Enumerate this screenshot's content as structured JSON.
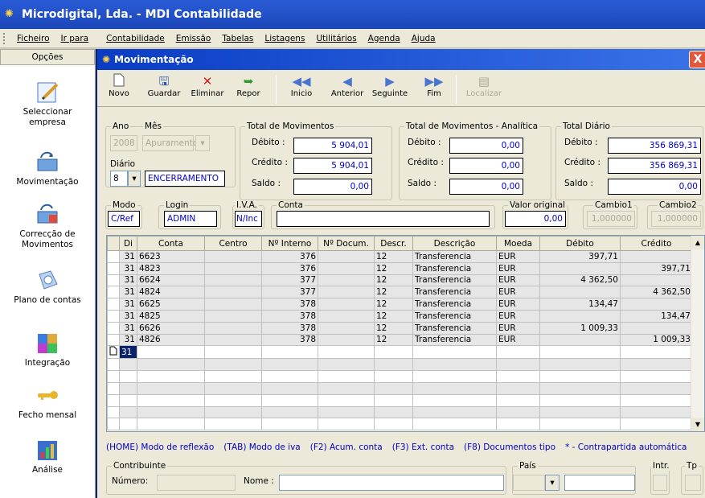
{
  "app": {
    "title": "Microdigital, Lda. - MDI Contabilidade"
  },
  "menu": [
    "Ficheiro",
    "Ir para",
    "Contabilidade",
    "Emissão",
    "Tabelas",
    "Listagens",
    "Utilitários",
    "Agenda",
    "Ajuda"
  ],
  "left": {
    "header": "Opções",
    "items": [
      {
        "label": "Seleccionar empresa",
        "icon": "edit-document-icon"
      },
      {
        "label": "Movimentação",
        "icon": "movements-icon"
      },
      {
        "label": "Correcção de Movimentos",
        "icon": "correction-icon"
      },
      {
        "label": "Plano de contas",
        "icon": "chart-of-accounts-icon"
      },
      {
        "label": "Integração",
        "icon": "integration-icon"
      },
      {
        "label": "Fecho mensal",
        "icon": "key-icon"
      },
      {
        "label": "Análise",
        "icon": "analysis-chart-icon"
      }
    ]
  },
  "window": {
    "title": "Movimentação",
    "close": "X"
  },
  "toolbar": [
    {
      "label": "Novo",
      "icon": "new-document-icon"
    },
    {
      "label": "Guardar",
      "icon": "save-icon"
    },
    {
      "label": "Eliminar",
      "icon": "delete-icon"
    },
    {
      "label": "Repor",
      "icon": "undo-icon"
    },
    {
      "label": "Inicio",
      "icon": "first-record-icon"
    },
    {
      "label": "Anterior",
      "icon": "previous-record-icon"
    },
    {
      "label": "Seguinte",
      "icon": "next-record-icon"
    },
    {
      "label": "Fim",
      "icon": "last-record-icon"
    },
    {
      "label": "Localizar",
      "icon": "find-icon",
      "disabled": true
    }
  ],
  "form": {
    "ano_label": "Ano",
    "ano": "2008",
    "mes_label": "Mês",
    "mes": "Apuramento",
    "diario_label": "Diário",
    "diario": "8",
    "diario_nome": "ENCERRAMENTO",
    "total_mov": {
      "title": "Total de Movimentos",
      "debito_label": "Débito :",
      "debito": "5 904,01",
      "credito_label": "Crédito :",
      "credito": "5 904,01",
      "saldo_label": "Saldo :",
      "saldo": "0,00"
    },
    "total_analitica": {
      "title": "Total de Movimentos - Analítica",
      "debito_label": "Débito :",
      "debito": "0,00",
      "credito_label": "Crédito :",
      "credito": "0,00",
      "saldo_label": "Saldo :",
      "saldo": "0,00"
    },
    "total_diario": {
      "title": "Total Diário",
      "debito_label": "Débito :",
      "debito": "356 869,31",
      "credito_label": "Crédito :",
      "credito": "356 869,31",
      "saldo_label": "Saldo :",
      "saldo": "0,00"
    },
    "modo_label": "Modo",
    "modo": "C/Ref",
    "login_label": "Login",
    "login": "ADMIN",
    "iva_label": "I.V.A.",
    "iva": "N/Inc",
    "conta_label": "Conta",
    "conta": "",
    "valor_original_label": "Valor original",
    "valor_original": "0,00",
    "cambio1_label": "Cambio1",
    "cambio1": "1,000000",
    "cambio2_label": "Cambio2",
    "cambio2": "1,000000"
  },
  "grid": {
    "columns": [
      "",
      "Di",
      "Conta",
      "Centro",
      "Nº Interno",
      "Nº Docum.",
      "Descr.",
      "Descrição",
      "Moeda",
      "Débito",
      "Crédito"
    ],
    "rows": [
      [
        "31",
        "6623",
        "",
        "376",
        "",
        "12",
        "Transferencia",
        "EUR",
        "397,71",
        ""
      ],
      [
        "31",
        "4823",
        "",
        "376",
        "",
        "12",
        "Transferencia",
        "EUR",
        "",
        "397,71"
      ],
      [
        "31",
        "6624",
        "",
        "377",
        "",
        "12",
        "Transferencia",
        "EUR",
        "4 362,50",
        ""
      ],
      [
        "31",
        "4824",
        "",
        "377",
        "",
        "12",
        "Transferencia",
        "EUR",
        "",
        "4 362,50"
      ],
      [
        "31",
        "6625",
        "",
        "378",
        "",
        "12",
        "Transferencia",
        "EUR",
        "134,47",
        ""
      ],
      [
        "31",
        "4825",
        "",
        "378",
        "",
        "12",
        "Transferencia",
        "EUR",
        "",
        "134,47"
      ],
      [
        "31",
        "6626",
        "",
        "378",
        "",
        "12",
        "Transferencia",
        "EUR",
        "1 009,33",
        ""
      ],
      [
        "31",
        "4826",
        "",
        "378",
        "",
        "12",
        "Transferencia",
        "EUR",
        "",
        "1 009,33"
      ]
    ],
    "new_row_day": "31",
    "empty_rows": 6
  },
  "hints": [
    "(HOME) Modo de reflexão",
    "(TAB) Modo de iva",
    "(F2) Acum. conta",
    "(F3) Ext. conta",
    "(F8) Documentos tipo",
    "* - Contrapartida automática"
  ],
  "contribuinte": {
    "title": "Contribuinte",
    "numero_label": "Número:",
    "numero": "",
    "nome_label": "Nome :",
    "nome": ""
  },
  "pais": {
    "label": "País",
    "value": ""
  },
  "intr_label": "Intr.",
  "tp_label": "Tp"
}
